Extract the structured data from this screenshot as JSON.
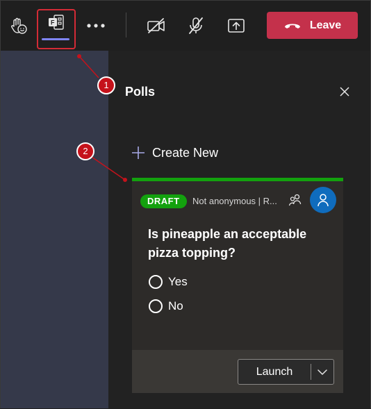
{
  "toolbar": {
    "items": [
      {
        "name": "raise-hand-button",
        "icon": "raise-hand-icon"
      },
      {
        "name": "apps-button",
        "icon": "forms-app-icon",
        "active": true
      },
      {
        "name": "more-options-button",
        "icon": "more-dots-icon"
      },
      {
        "name": "camera-toggle-button",
        "icon": "camera-off-icon"
      },
      {
        "name": "mic-toggle-button",
        "icon": "mic-off-icon"
      },
      {
        "name": "share-button",
        "icon": "share-tray-icon"
      }
    ],
    "leave_label": "Leave",
    "leave_color": "#c4314b",
    "active_underline_color": "#7f85f5"
  },
  "panel": {
    "title": "Polls",
    "create_new_label": "Create New"
  },
  "poll": {
    "status": "DRAFT",
    "meta": "Not anonymous | R...",
    "question": "Is pineapple an acceptable pizza topping?",
    "options": [
      "Yes",
      "No"
    ],
    "launch_label": "Launch",
    "accent_color": "#13a10e"
  },
  "callouts": [
    "1",
    "2"
  ],
  "callout_color": "#c5121b"
}
